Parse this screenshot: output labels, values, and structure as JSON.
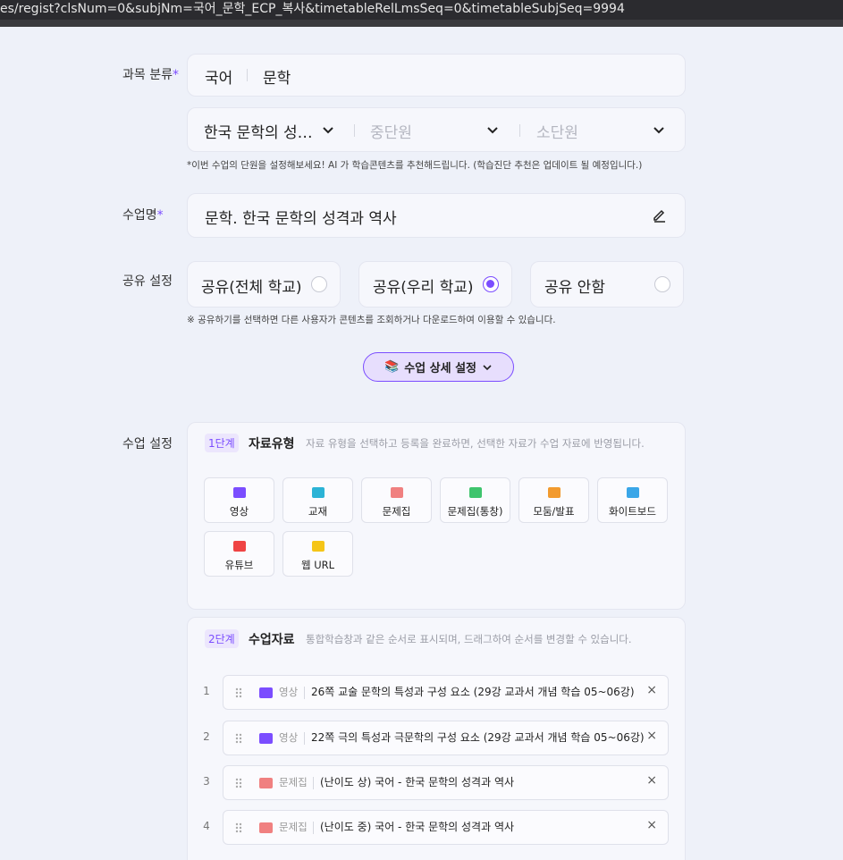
{
  "browser": {
    "url": "es/regist?clsNum=0&subjNm=국어_문학_ECP_복사&timetableRelLmsSeq=0&timetableSubjSeq=9994"
  },
  "form": {
    "subject_label": "과목 분류",
    "required_mark": "*",
    "subject": {
      "main": "국어",
      "sub": "문학"
    },
    "unit": {
      "big": "한국 문학의 성…",
      "mid_placeholder": "중단원",
      "small_placeholder": "소단원",
      "divider": "|"
    },
    "unit_note": "*이번 수업의 단원을 설정해보세요! AI 가 학습콘텐츠를 추천해드립니다. (학습진단 추천은 업데이트 될 예정입니다.)",
    "class_name_label": "수업명",
    "class_name": "문학. 한국 문학의 성격과 역사",
    "share_label": "공유 설정",
    "share_options": [
      {
        "label": "공유(전체 학교)",
        "selected": false
      },
      {
        "label": "공유(우리 학교)",
        "selected": true
      },
      {
        "label": "공유 안함",
        "selected": false
      }
    ],
    "share_note": "※ 공유하기를 선택하면 다른 사용자가 콘텐츠를 조회하거나 다운로드하여 이용할 수 있습니다.",
    "detail_button": {
      "emoji": "📚",
      "label": "수업 상세 설정"
    },
    "class_setting_label": "수업 설정"
  },
  "step1": {
    "badge": "1단계",
    "title": "자료유형",
    "desc": "자료 유형을 선택하고 등록을 완료하면, 선택한 자료가 수업 자료에 반영됩니다.",
    "types": [
      {
        "label": "영상",
        "color": "#7b4dff"
      },
      {
        "label": "교재",
        "color": "#2bb3d6"
      },
      {
        "label": "문제집",
        "color": "#f08080"
      },
      {
        "label": "문제집(통창)",
        "color": "#3ec46d"
      },
      {
        "label": "모둠/발표",
        "color": "#f29a2e"
      },
      {
        "label": "화이트보드",
        "color": "#3aa6e8"
      },
      {
        "label": "유튜브",
        "color": "#ef4444"
      },
      {
        "label": "웹 URL",
        "color": "#f5c518"
      }
    ]
  },
  "step2": {
    "badge": "2단계",
    "title": "수업자료",
    "desc": "통합학습창과 같은 순서로 표시되며, 드래그하여 순서를 변경할 수 있습니다.",
    "items": [
      {
        "num": "1",
        "type": "영상",
        "title": "26쪽 교술 문학의 특성과 구성 요소 (29강 교과서 개념 학습 05~06강)",
        "color": "#7b4dff",
        "close": "×"
      },
      {
        "num": "2",
        "type": "영상",
        "title": "22쪽 극의 특성과 극문학의 구성 요소 (29강 교과서 개념 학습 05~06강)",
        "color": "#7b4dff",
        "close": "×"
      },
      {
        "num": "3",
        "type": "문제집",
        "title": "(난이도 상) 국어 - 한국 문학의 성격과 역사",
        "color": "#f08080",
        "close": "×"
      },
      {
        "num": "4",
        "type": "문제집",
        "title": "(난이도 중) 국어 - 한국 문학의 성격과 역사",
        "color": "#f08080",
        "close": "×"
      }
    ]
  }
}
